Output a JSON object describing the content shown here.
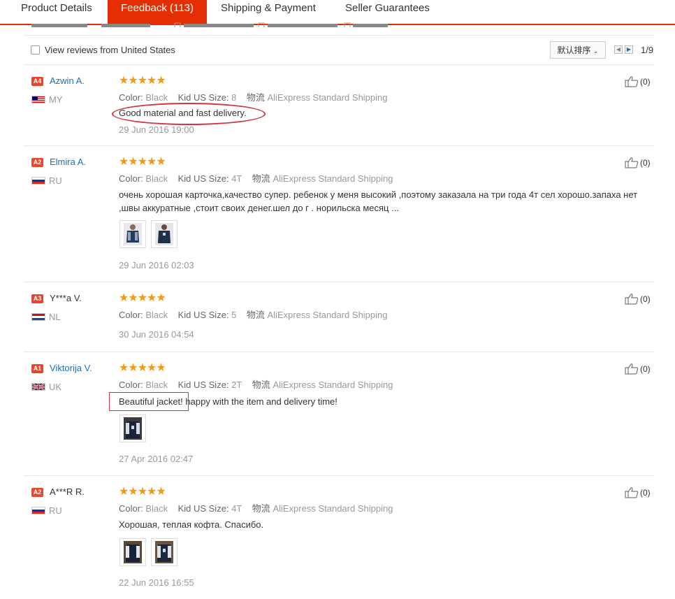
{
  "tabs": [
    {
      "label": "Product Details"
    },
    {
      "label": "Feedback (113)"
    },
    {
      "label": "Shipping & Payment"
    },
    {
      "label": "Seller Guarantees"
    }
  ],
  "filter": {
    "label": "View reviews from United States"
  },
  "sort": {
    "label": "默认排序"
  },
  "pager": {
    "page": "1/9"
  },
  "colors": {
    "accent": "#e62e04",
    "link": "#1c6fb6",
    "star": "#f39a15",
    "badge": "#e8452a"
  },
  "reviews": [
    {
      "level": "A4",
      "name": "Azwin A.",
      "country": "MY",
      "stars": "★★★★★",
      "color_label": "Color:",
      "color": "Black",
      "size_label": "Kid US Size:",
      "size": "8",
      "ship_label": "物流",
      "ship": "AliExpress Standard Shipping",
      "text": "Good material and fast delivery.",
      "date": "29 Jun 2016 19:00",
      "likes": "(0)"
    },
    {
      "level": "A2",
      "name": "Elmira A.",
      "country": "RU",
      "stars": "★★★★★",
      "color_label": "Color:",
      "color": "Black",
      "size_label": "Kid US Size:",
      "size": "4T",
      "ship_label": "物流",
      "ship": "AliExpress Standard Shipping",
      "text": "очень хорошая карточка,качество супер. ребенок у меня высокий ,поэтому заказала на три года 4т сел хорошо.запаха нет ,швы аккуратные ,стоит своих денег.шел до г . норильска месяц ...",
      "date": "29 Jun 2016 02:03",
      "likes": "(0)"
    },
    {
      "level": "A3",
      "name": "Y***a V.",
      "country": "NL",
      "stars": "★★★★★",
      "color_label": "Color:",
      "color": "Black",
      "size_label": "Kid US Size:",
      "size": "5",
      "ship_label": "物流",
      "ship": "AliExpress Standard Shipping",
      "text": "",
      "date": "30 Jun 2016 04:54",
      "likes": "(0)"
    },
    {
      "level": "A1",
      "name": "Viktorija V.",
      "country": "UK",
      "stars": "★★★★★",
      "color_label": "Color:",
      "color": "Black",
      "size_label": "Kid US Size:",
      "size": "2T",
      "ship_label": "物流",
      "ship": "AliExpress Standard Shipping",
      "text_a": "Beautiful jacket!",
      "text_b": " happy with the item and delivery time!",
      "date": "27 Apr 2016 02:47",
      "likes": "(0)"
    },
    {
      "level": "A2",
      "name": "A***R R.",
      "country": "RU",
      "stars": "★★★★★",
      "color_label": "Color:",
      "color": "Black",
      "size_label": "Kid US Size:",
      "size": "4T",
      "ship_label": "物流",
      "ship": "AliExpress Standard Shipping",
      "text": "Хорошая, теплая кофта. Спасибо.",
      "date": "22 Jun 2016 16:55",
      "likes": "(0)"
    }
  ]
}
